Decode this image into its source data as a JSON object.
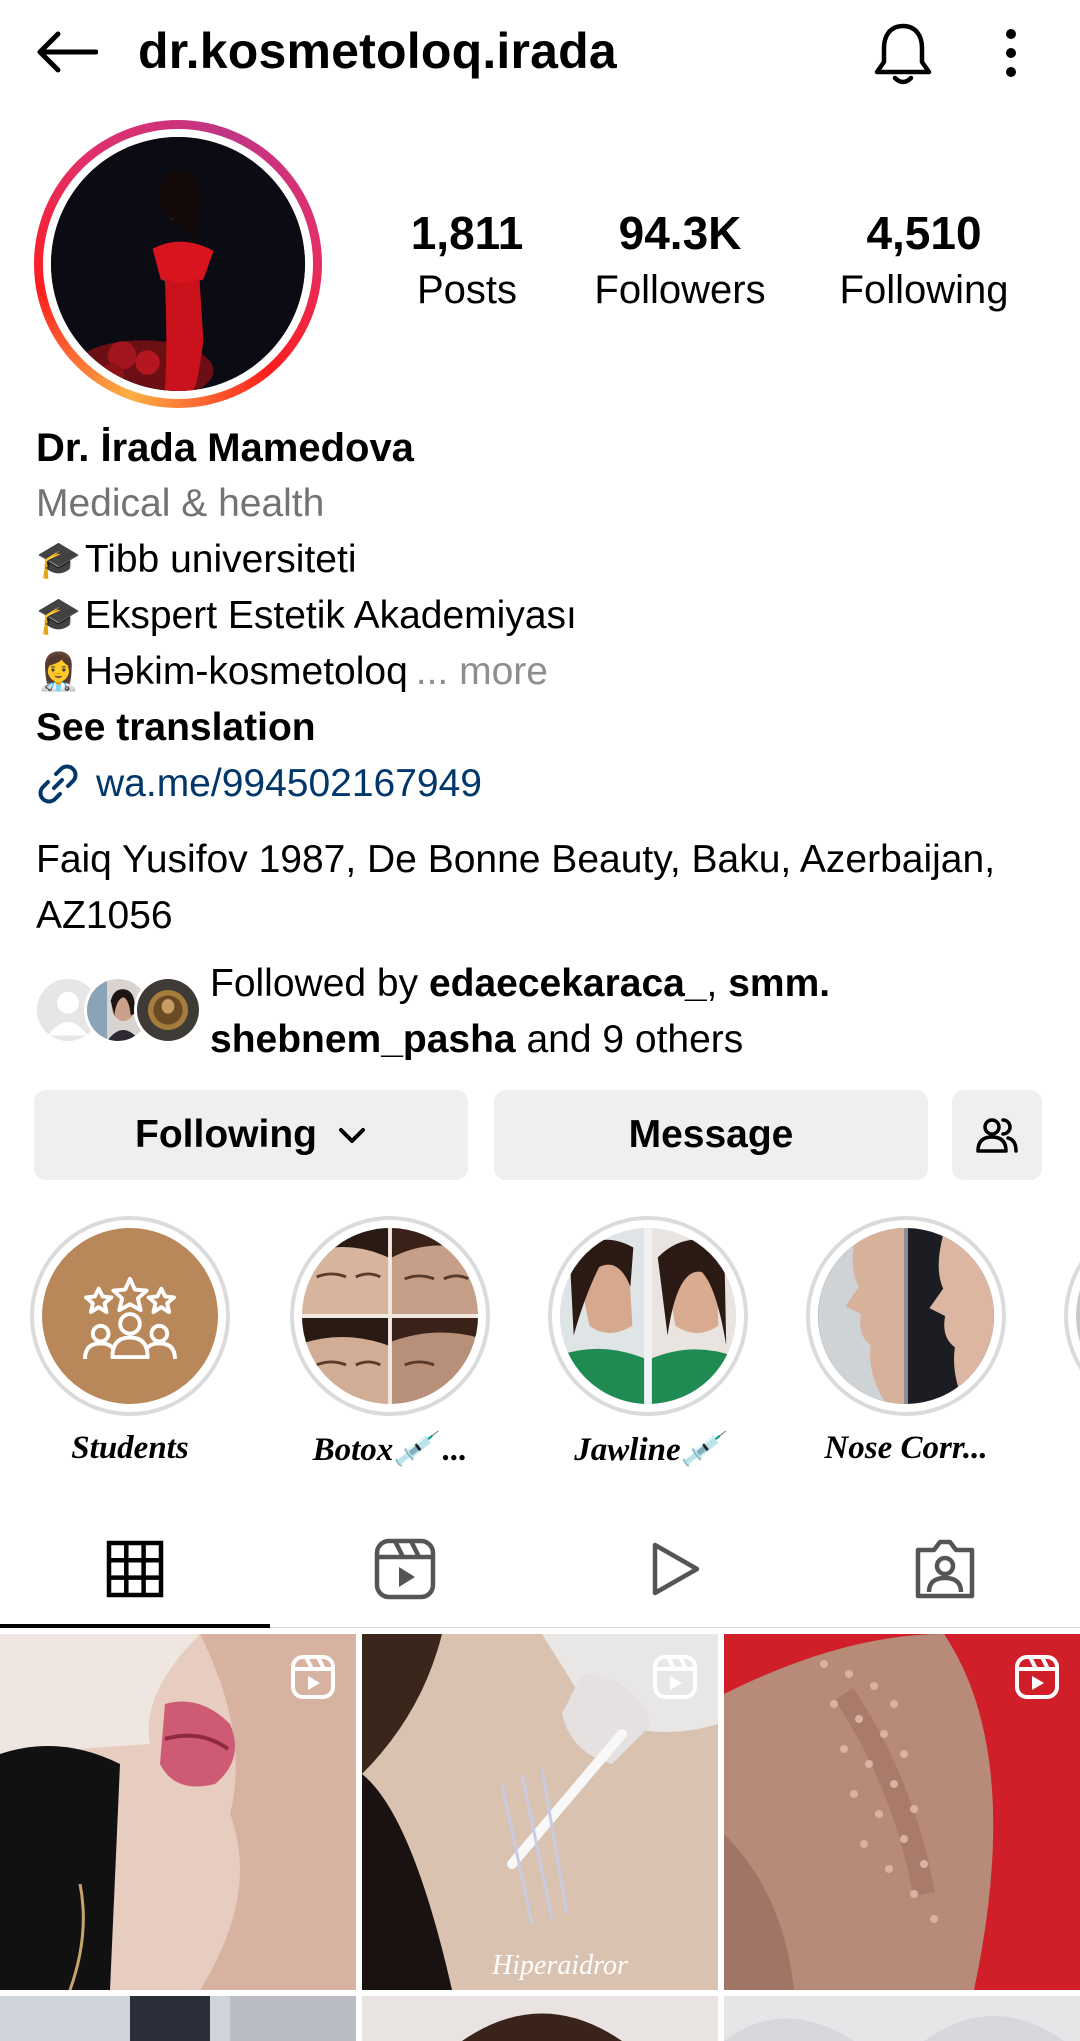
{
  "header": {
    "username": "dr.kosmetoloq.irada",
    "back_icon": "arrow-left-icon",
    "bell_icon": "bell-icon",
    "more_icon": "more-vertical-icon"
  },
  "stats": {
    "posts_count": "1,811",
    "posts_label": "Posts",
    "followers_count": "94.3K",
    "followers_label": "Followers",
    "following_count": "4,510",
    "following_label": "Following"
  },
  "bio": {
    "display_name": "Dr. İrada Mamedova",
    "category": "Medical & health",
    "line1_emoji": "🎓",
    "line1_text": "Tibb universiteti",
    "line2_emoji": "🎓",
    "line2_text": "Ekspert Estetik Akademiyası",
    "line3_emoji": "👩‍⚕️",
    "line3_text": "Həkim-kosmetoloq",
    "more_label": "... more",
    "see_translation": "See translation",
    "link": "wa.me/994502167949",
    "address": "Faiq Yusifov 1987, De Bonne Beauty, Baku, Azerbaijan, AZ1056"
  },
  "followed_by": {
    "prefix": "Followed by ",
    "user1": "edaecekaraca_",
    "separator": ", ",
    "user2": "smm. shebnem_pasha",
    "suffix": " and 9 others"
  },
  "actions": {
    "following_label": "Following",
    "message_label": "Message",
    "suggest_icon": "add-people-icon"
  },
  "highlights": [
    {
      "label": "Students"
    },
    {
      "label": "Botox💉 ..."
    },
    {
      "label": "Jawline💉"
    },
    {
      "label": "Nose Corr..."
    }
  ],
  "tabs": {
    "grid_icon": "grid-icon",
    "reels_icon": "reels-icon",
    "videos_icon": "play-icon",
    "tagged_icon": "tagged-user-icon"
  },
  "colors": {
    "accent_link": "#00376b",
    "button_bg": "#efefef",
    "secondary_text": "#737373",
    "students_highlight": "#b8875a"
  }
}
